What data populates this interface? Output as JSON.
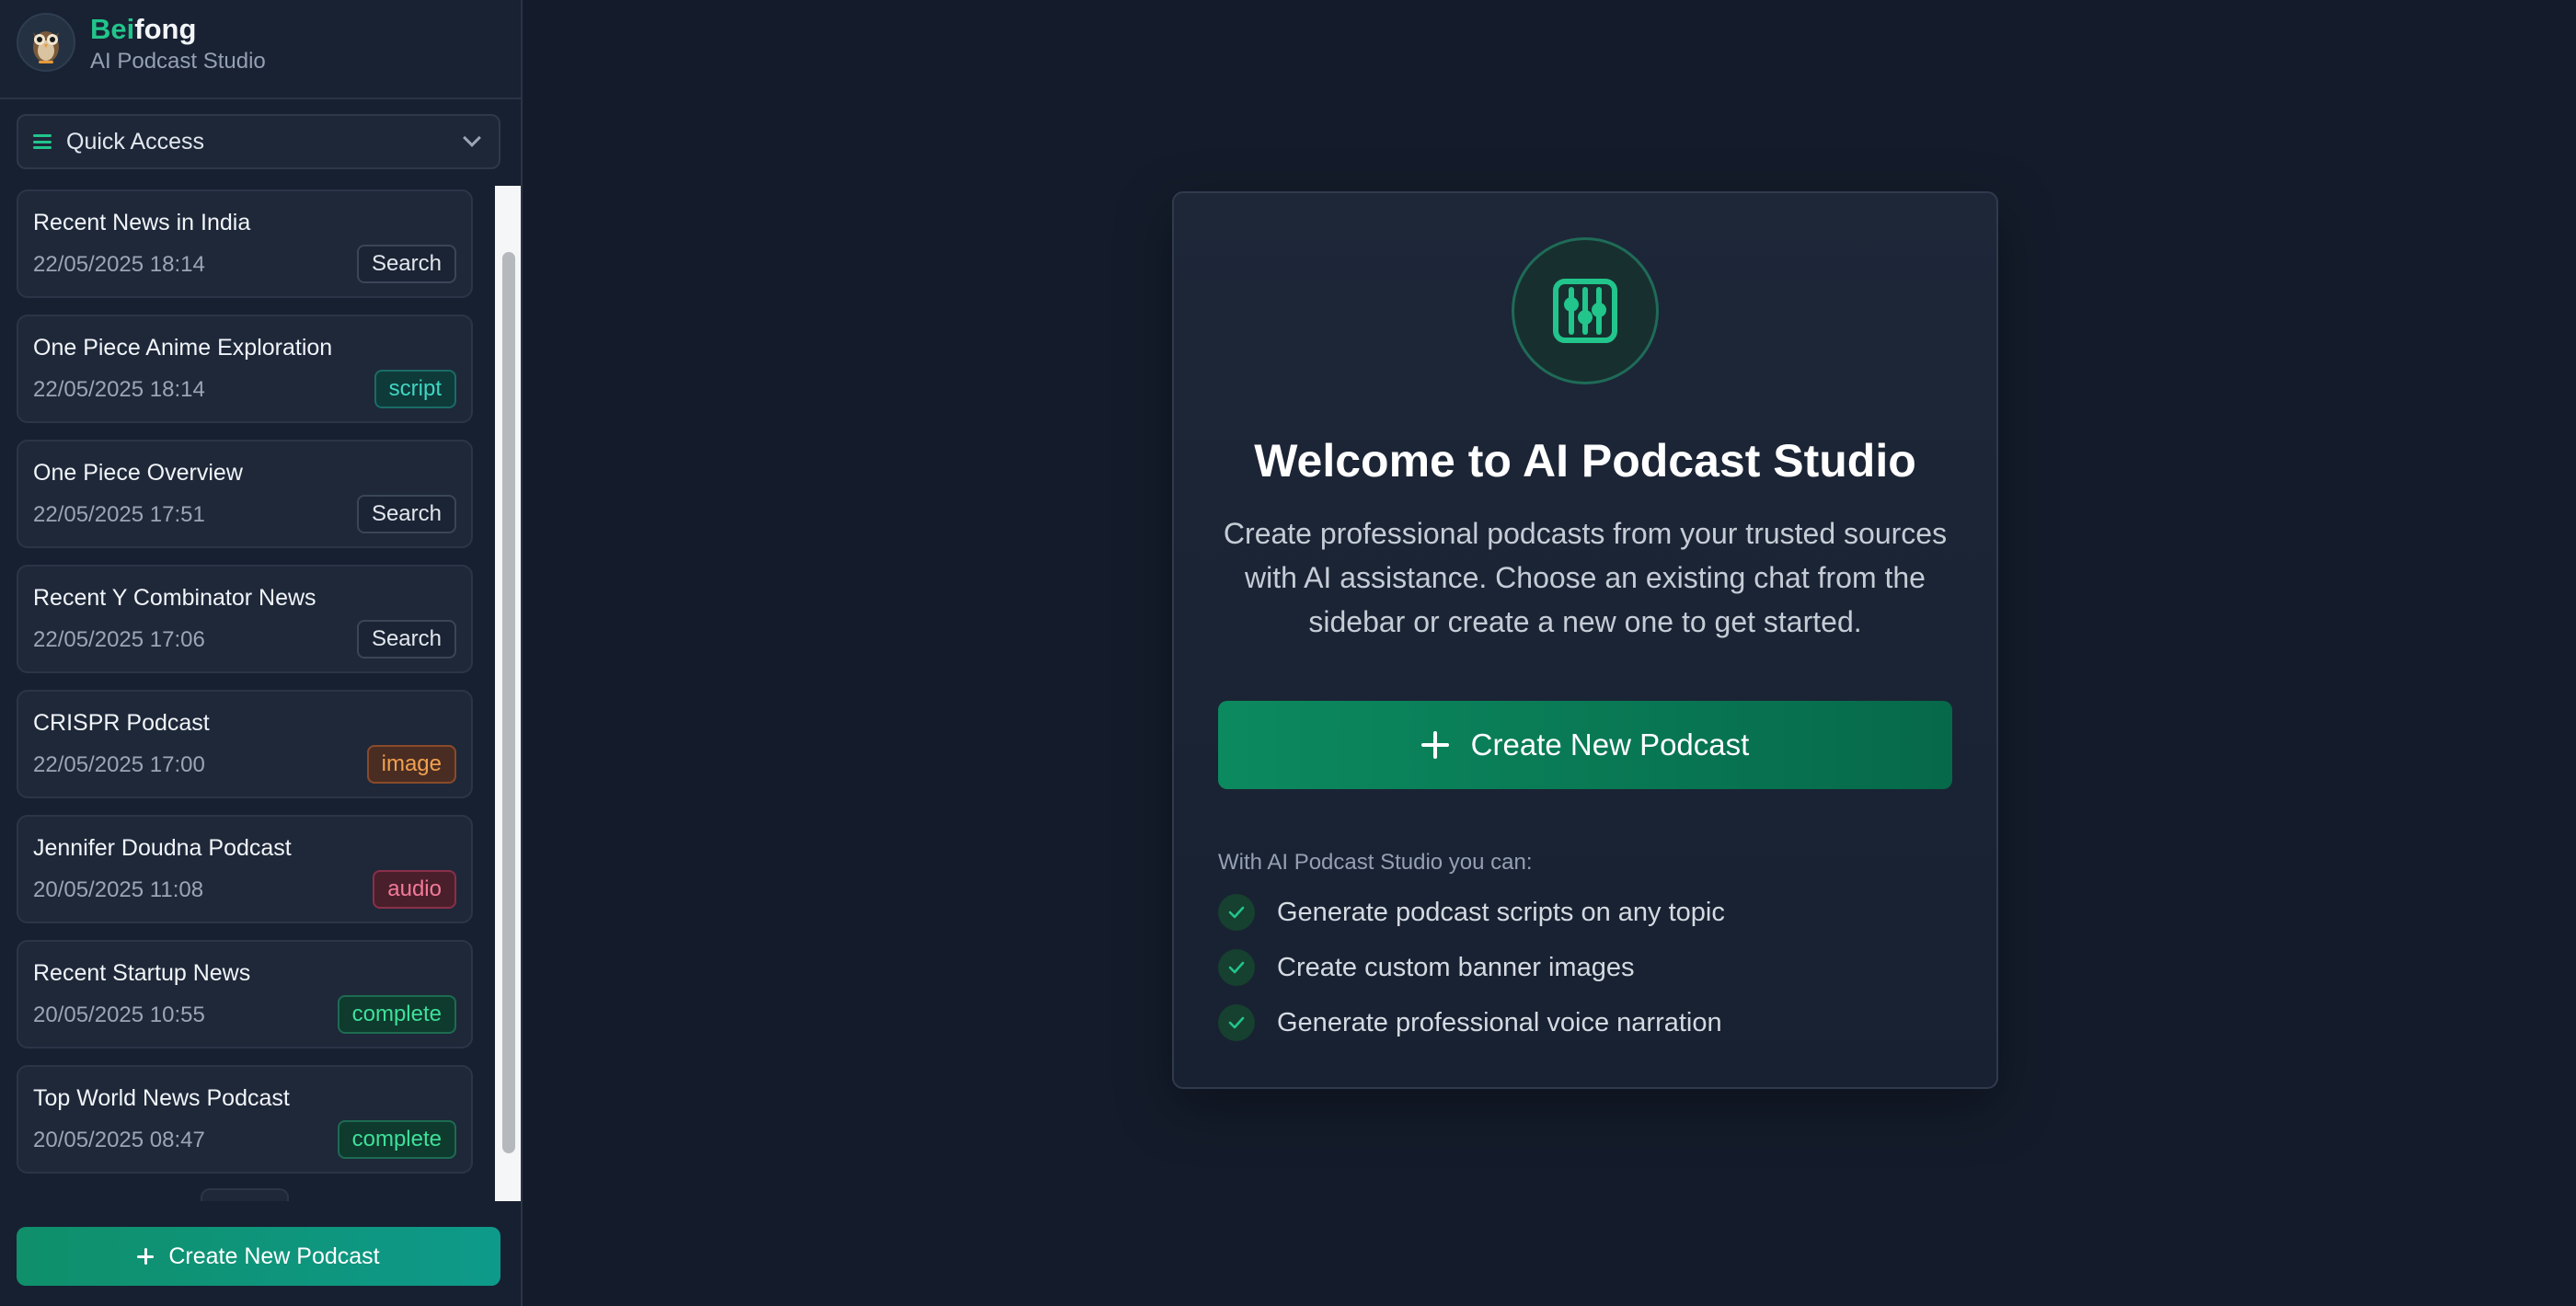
{
  "colors": {
    "accent": "#22c58b",
    "background": "#141c2b",
    "sidebar": "#172031",
    "card": "#1d2738",
    "primary_button": "#0c8a5f"
  },
  "brand": {
    "name_accent": "Bei",
    "name_rest": "fong",
    "subtitle": "AI Podcast Studio",
    "logo_icon": "owl-icon"
  },
  "quick_access": {
    "label": "Quick Access",
    "icon": "menu-icon",
    "chevron": "chevron-down-icon"
  },
  "sessions": [
    {
      "title": "Recent News in India",
      "date": "22/05/2025 18:14",
      "badge": "Search",
      "badge_type": "search"
    },
    {
      "title": "One Piece Anime Exploration",
      "date": "22/05/2025 18:14",
      "badge": "script",
      "badge_type": "script"
    },
    {
      "title": "One Piece Overview",
      "date": "22/05/2025 17:51",
      "badge": "Search",
      "badge_type": "search"
    },
    {
      "title": "Recent Y Combinator News",
      "date": "22/05/2025 17:06",
      "badge": "Search",
      "badge_type": "search"
    },
    {
      "title": "CRISPR Podcast",
      "date": "22/05/2025 17:00",
      "badge": "image",
      "badge_type": "image"
    },
    {
      "title": "Jennifer Doudna Podcast",
      "date": "20/05/2025 11:08",
      "badge": "audio",
      "badge_type": "audio"
    },
    {
      "title": "Recent Startup News",
      "date": "20/05/2025 10:55",
      "badge": "complete",
      "badge_type": "complete"
    },
    {
      "title": "Top World News Podcast",
      "date": "20/05/2025 08:47",
      "badge": "complete",
      "badge_type": "complete"
    }
  ],
  "sidebar_create_label": "Create New Podcast",
  "welcome": {
    "icon": "sliders-icon",
    "title": "Welcome to AI Podcast Studio",
    "description": "Create professional podcasts from your trusted sources with AI assistance. Choose an existing chat from the sidebar or create a new one to get started.",
    "create_label": "Create New Podcast",
    "features_label": "With AI Podcast Studio you can:",
    "features": [
      "Generate podcast scripts on any topic",
      "Create custom banner images",
      "Generate professional voice narration"
    ]
  }
}
